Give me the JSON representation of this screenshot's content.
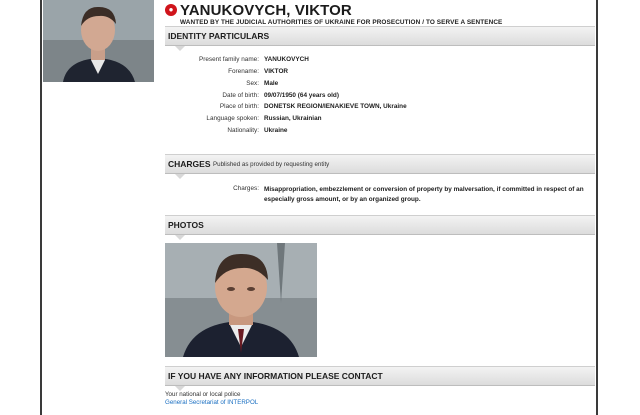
{
  "header": {
    "icon_glyph": "●",
    "name": "YANUKOVYCH, VIKTOR",
    "wanted_text": "WANTED BY THE JUDICIAL AUTHORITIES OF UKRAINE FOR PROSECUTION / TO SERVE A SENTENCE"
  },
  "sections": {
    "identity": "IDENTITY PARTICULARS",
    "charges": "CHARGES",
    "charges_sub": "Published as provided by requesting entity",
    "photos": "PHOTOS",
    "contact": "IF YOU HAVE ANY INFORMATION PLEASE CONTACT"
  },
  "identity": [
    {
      "label": "Present family name:",
      "value": "YANUKOVYCH"
    },
    {
      "label": "Forename:",
      "value": "VIKTOR"
    },
    {
      "label": "Sex:",
      "value": "Male"
    },
    {
      "label": "Date of birth:",
      "value": "09/07/1950 (64 years old)"
    },
    {
      "label": "Place of birth:",
      "value": "DONETSK REGION/IENAKIEVE TOWN, Ukraine"
    },
    {
      "label": "Language spoken:",
      "value": "Russian, Ukrainian"
    },
    {
      "label": "Nationality:",
      "value": "Ukraine"
    }
  ],
  "charges": {
    "label": "Charges:",
    "text": "Misappropriation, embezzlement or conversion of property by malversation, if committed in respect of an especially gross amount, or by an organized group."
  },
  "contact": {
    "line1": "Your national or local police",
    "link": "General Secretariat of INTERPOL"
  },
  "colors": {
    "notice_red": "#d0141b",
    "link_blue": "#1a6fc2"
  }
}
